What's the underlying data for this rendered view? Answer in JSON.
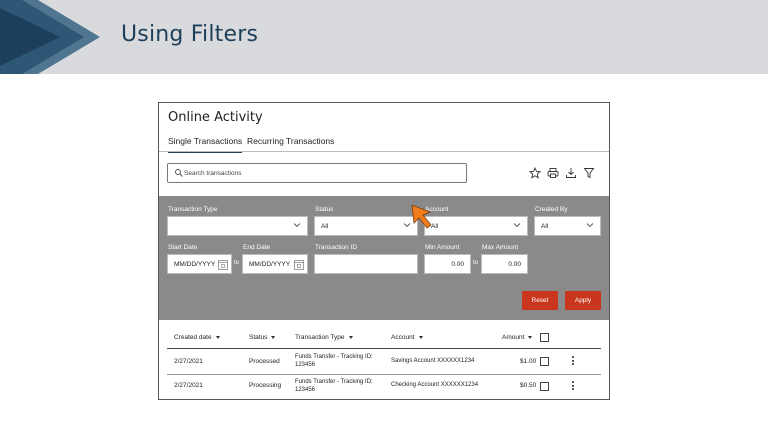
{
  "slide": {
    "title": "Using Filters"
  },
  "panel": {
    "title": "Online Activity",
    "tabs": [
      {
        "label": "Single Transactions",
        "active": true
      },
      {
        "label": "Recurring Transactions",
        "active": false
      }
    ],
    "search": {
      "placeholder": "Search transactions",
      "value": ""
    },
    "toolbar": [
      "star-icon",
      "print-icon",
      "download-icon",
      "filter-icon"
    ]
  },
  "filters": {
    "transaction_type": {
      "label": "Transaction Type",
      "value": ""
    },
    "status": {
      "label": "Status",
      "value": "All"
    },
    "account": {
      "label": "Account",
      "value": "All"
    },
    "created_by": {
      "label": "Created By",
      "value": "All"
    },
    "start_date": {
      "label": "Start Date",
      "value": "MM/DD/YYYY"
    },
    "to_label": "to",
    "end_date": {
      "label": "End Date",
      "value": "MM/DD/YYYY"
    },
    "transaction_id": {
      "label": "Transaction ID",
      "value": ""
    },
    "min_amount": {
      "label": "Min Amount",
      "value": "0.00"
    },
    "max_amount": {
      "label": "Max Amount",
      "value": "0.00"
    },
    "reset_label": "Reset",
    "apply_label": "Apply",
    "accent_color": "#c9361d",
    "panel_color": "#8a8a8a"
  },
  "table": {
    "columns": [
      "Created date",
      "Status",
      "Transaction Type",
      "Account",
      "Amount"
    ],
    "rows": [
      {
        "date": "2/27/2021",
        "status": "Processed",
        "type_line1": "Funds Transfer -  Tracking ID:",
        "type_line2": "123456",
        "account": "Savings Account XXXXXX1234",
        "amount": "$1.00"
      },
      {
        "date": "2/27/2021",
        "status": "Processing",
        "type_line1": "Funds Transfer -  Tracking ID:",
        "type_line2": "123456",
        "account": "Checking Account XXXXXX1234",
        "amount": "$0.50"
      }
    ]
  },
  "colors": {
    "header_bg": "#d8dadd",
    "title": "#1e3f5a",
    "chevron_dark": "#1c3f5c",
    "chevron_light": "#4f7591",
    "cursor": "#f07c1c"
  }
}
